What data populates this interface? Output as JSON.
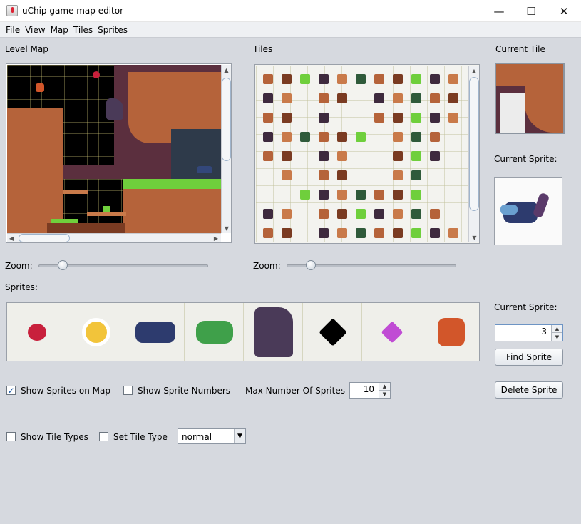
{
  "window": {
    "title": "uChip game map editor",
    "minimize": "—",
    "maximize": "☐",
    "close": "✕"
  },
  "menu": [
    "File",
    "View",
    "Map",
    "Tiles",
    "Sprites"
  ],
  "level_map": {
    "label": "Level Map",
    "zoom_label": "Zoom:",
    "zoom_value": 0.12
  },
  "tiles": {
    "label": "Tiles",
    "zoom_label": "Zoom:",
    "zoom_value": 0.12
  },
  "current_tile": {
    "label": "Current Tile"
  },
  "current_sprite_preview": {
    "label": "Current Sprite:"
  },
  "sprites": {
    "label": "Sprites:",
    "items": [
      "cherry",
      "star-coin",
      "opossum",
      "frog",
      "eagle",
      "black-diamond",
      "gem",
      "fox-creature"
    ]
  },
  "current_sprite_control": {
    "label": "Current Sprite:",
    "value": "3",
    "find_button": "Find Sprite",
    "delete_button": "Delete Sprite"
  },
  "options": {
    "show_sprites": {
      "label": "Show Sprites on Map",
      "checked": true
    },
    "show_numbers": {
      "label": "Show Sprite Numbers",
      "checked": false
    },
    "max_sprites_label": "Max Number Of Sprites",
    "max_sprites_value": "10",
    "show_tile_types": {
      "label": "Show Tile Types",
      "checked": false
    },
    "set_tile_type": {
      "label": "Set Tile Type",
      "checked": false
    },
    "tile_type_selected": "normal"
  },
  "colors": {
    "accent": "#1e5aa8",
    "dirt": "#b5633a",
    "dirt_dark": "#7a3b22",
    "grass": "#6fcf3c",
    "rock_bg": "#5a3040"
  }
}
